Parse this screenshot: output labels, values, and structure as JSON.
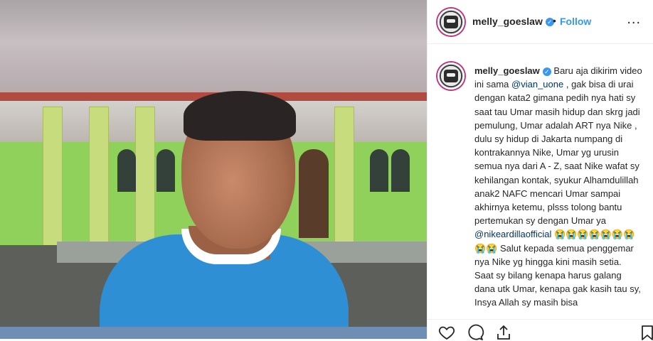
{
  "post": {
    "username": "melly_goeslaw",
    "follow_label": "Follow",
    "more_label": "...",
    "separator": "•",
    "verified_glyph": "✓"
  },
  "caption": {
    "username": "melly_goeslaw",
    "segments": [
      {
        "type": "text",
        "value": " Baru aja dikirim video ini sama "
      },
      {
        "type": "mention",
        "value": "@vian_uone"
      },
      {
        "type": "text",
        "value": " , gak bisa di urai dengan kata2 gimana pedih nya hati sy saat tau Umar masih hidup dan skrg jadi pemulung, Umar adalah ART nya Nike , dulu sy hidup di Jakarta numpang di kontrakannya Nike, Umar yg urusin semua nya dari A - Z, saat Nike wafat sy kehilangan kontak, syukur Alhamdulillah anak2 NAFC mencari Umar sampai akhirnya ketemu, plsss tolong bantu pertemukan sy dengan Umar ya "
      },
      {
        "type": "mention",
        "value": "@nikeardillaofficial"
      },
      {
        "type": "text",
        "value": " 😭😭😭😭😭😭😭😭😭 Salut kepada semua penggemar nya Nike yg hingga kini masih setia."
      },
      {
        "type": "text",
        "value": "Saat sy bilang kenapa harus galang dana utk Umar, kenapa gak kasih tau sy, Insya Allah sy masih bisa"
      }
    ]
  },
  "icons": {
    "like": "heart-icon",
    "comment": "comment-icon",
    "share": "share-icon",
    "save": "bookmark-icon",
    "verified": "verified-badge-icon",
    "more": "more-options-icon"
  },
  "colors": {
    "link": "#3897f0",
    "mention": "#003569",
    "text": "#262626",
    "border": "#efefef"
  }
}
